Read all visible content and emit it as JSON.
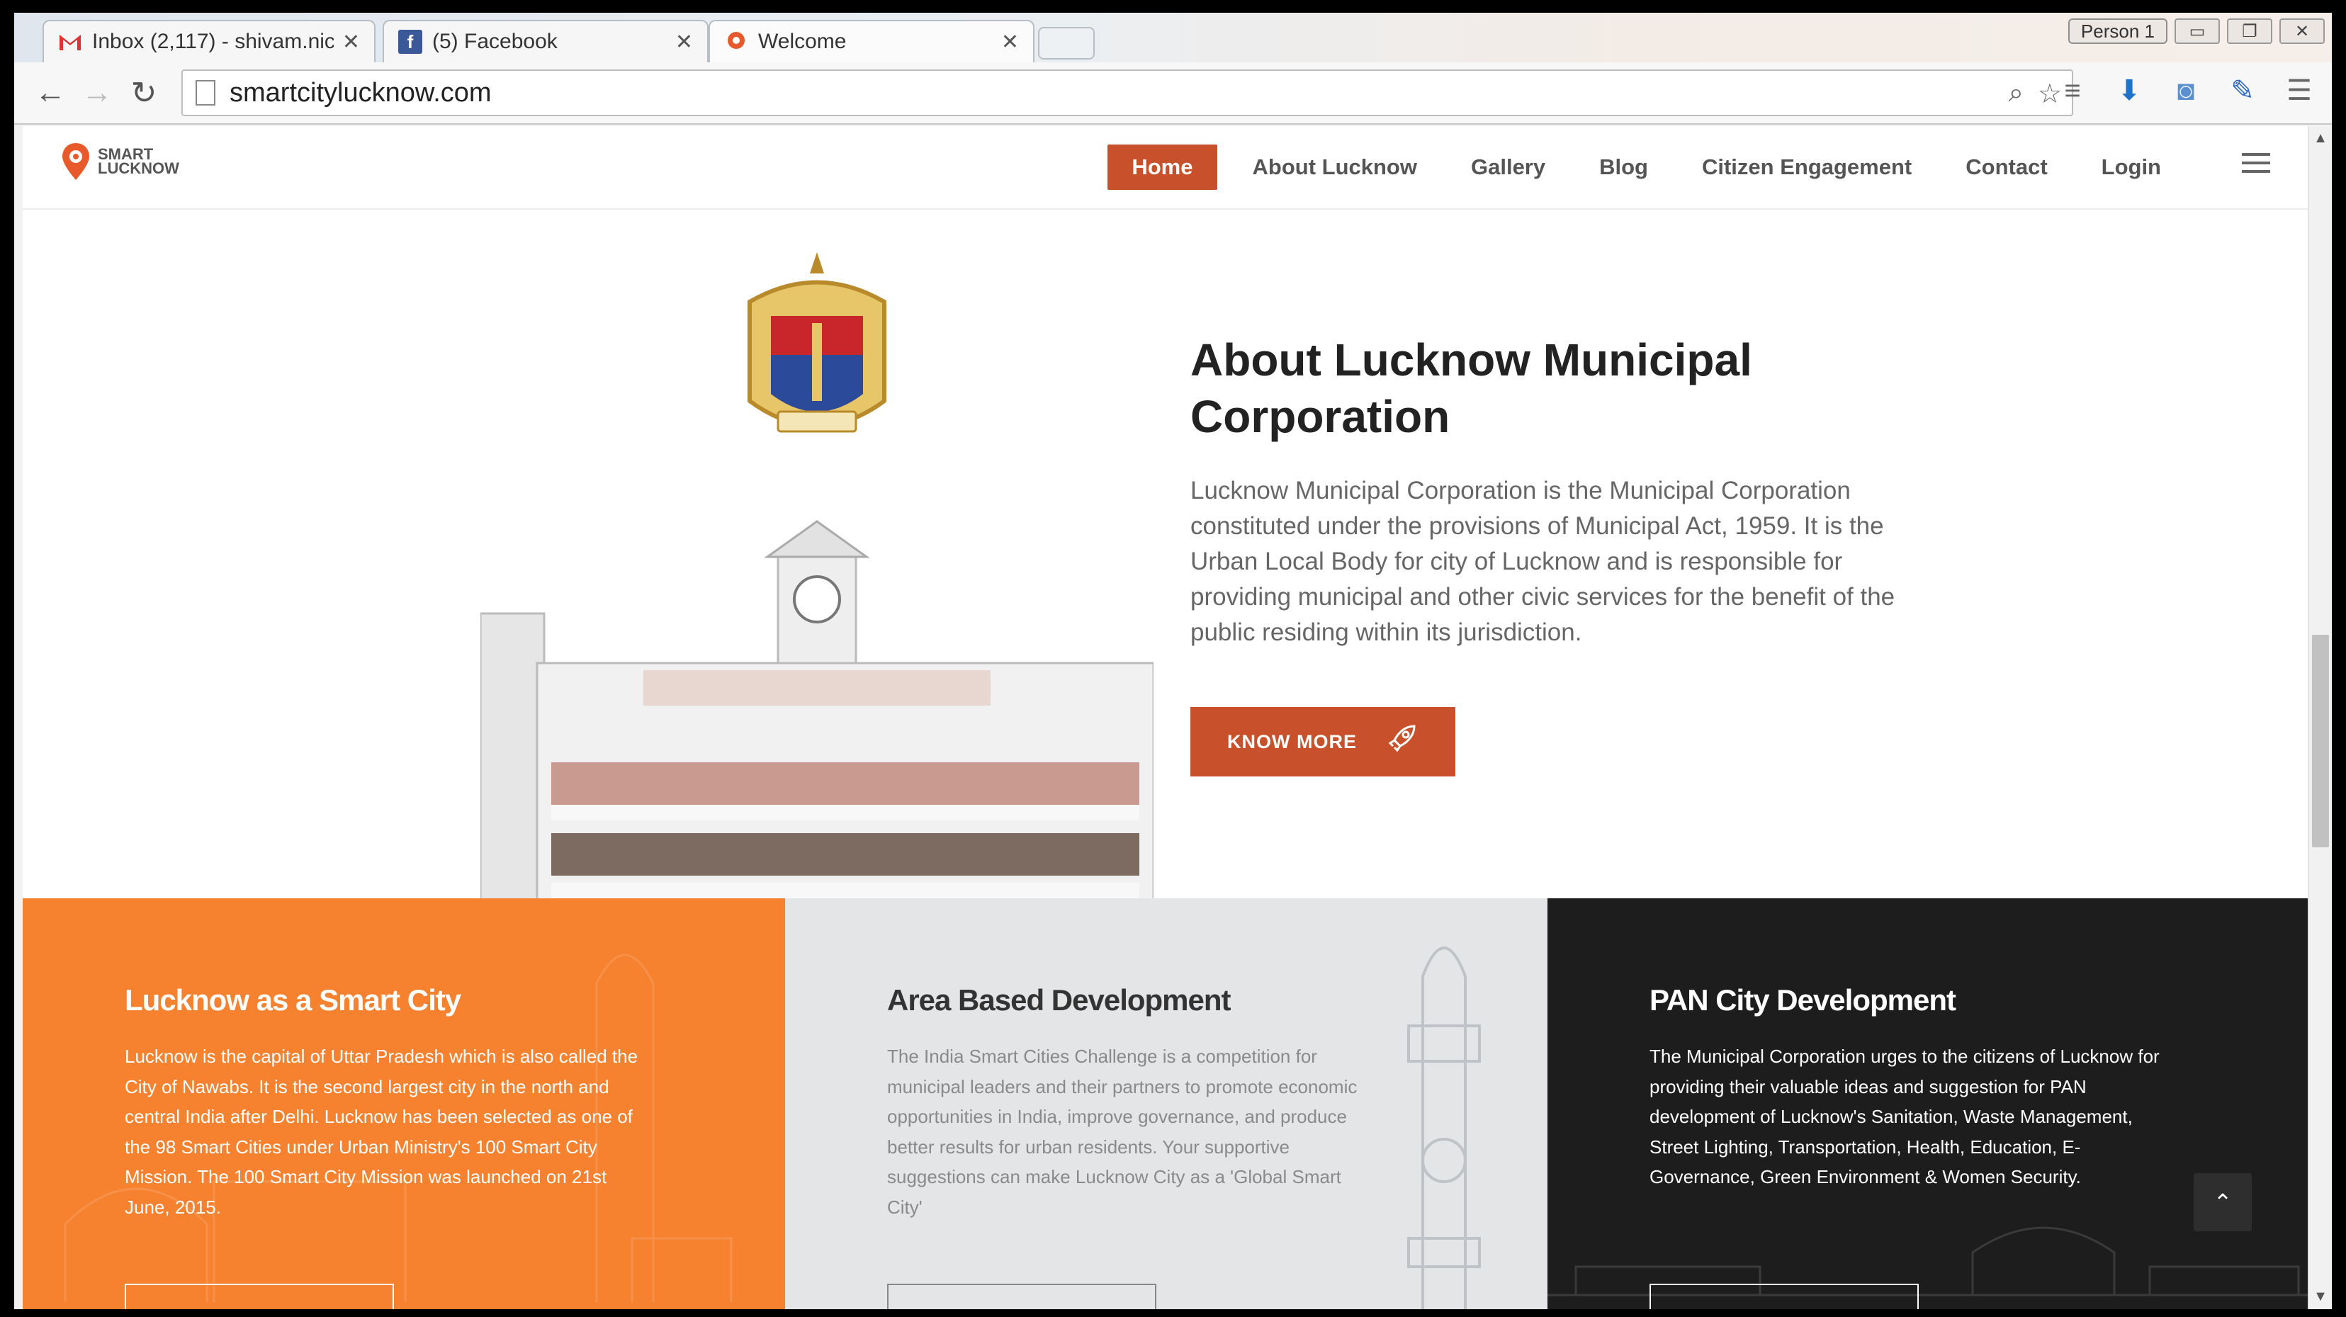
{
  "browser": {
    "tabs": [
      {
        "title": "Inbox (2,117) - shivam.nic",
        "favicon": "gmail-icon"
      },
      {
        "title": "(5) Facebook",
        "favicon": "facebook-icon"
      },
      {
        "title": "Welcome",
        "favicon": "smartcity-icon"
      }
    ],
    "person_label": "Person 1",
    "url": "smartcitylucknow.com"
  },
  "site": {
    "logo_line1": "SMART",
    "logo_line2": "LUCKNOW",
    "nav": [
      "Home",
      "About Lucknow",
      "Gallery",
      "Blog",
      "Citizen Engagement",
      "Contact",
      "Login"
    ],
    "active_nav": "Home"
  },
  "about": {
    "title": "About Lucknow Municipal Corporation",
    "text": "Lucknow Municipal Corporation is the Municipal Corporation constituted under the provisions of Municipal Act, 1959. It is the Urban Local Body for city of Lucknow and is responsible for providing municipal and other civic services for the benefit of the public residing within its jurisdiction.",
    "button_label": "KNOW MORE"
  },
  "columns": [
    {
      "title": "Lucknow as a Smart City",
      "text": "Lucknow is the capital of Uttar Pradesh which is also called the City of Nawabs. It is the second largest city in the north and central India after Delhi. Lucknow has been selected as one of the 98 Smart Cities under Urban Ministry's 100 Smart City Mission. The 100 Smart City Mission was launched on 21st June, 2015."
    },
    {
      "title": "Area Based Development",
      "text": "The India Smart Cities Challenge is a competition for municipal leaders and their partners to promote economic opportunities in India, improve governance, and produce better results for urban residents. Your supportive suggestions can make Lucknow City as a 'Global Smart City'"
    },
    {
      "title": "PAN City Development",
      "text": "The Municipal Corporation urges to the citizens of Lucknow for providing their valuable ideas and suggestion for PAN development of Lucknow's Sanitation, Waste Management, Street Lighting, Transportation, Health, Education, E-Governance, Green Environment & Women Security."
    }
  ],
  "colors": {
    "accent": "#c8502a",
    "orange": "#f6812e",
    "grey": "#e3e5e7",
    "dark": "#1d1d1d"
  }
}
